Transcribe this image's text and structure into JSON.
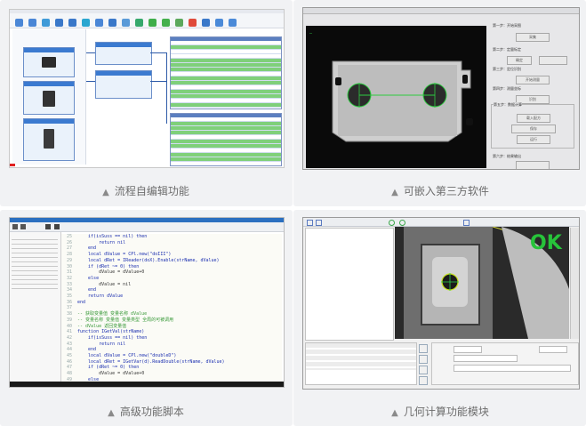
{
  "captions": {
    "flow_editor": "流程自编辑功能",
    "third_party": "可嵌入第三方软件",
    "advanced_script": "高级功能脚本",
    "geometry": "几何计算功能模块"
  },
  "bullet": "▲",
  "third_party": {
    "steps": [
      "第一步：开始采图",
      "第二步：定量标定",
      "第三步：定位识别",
      "第四步：测量坐标",
      "第五步：数据计算",
      "第六步：结果输出"
    ],
    "buttons": [
      "采集",
      "确定",
      "开始测量",
      "识别",
      "载入配方",
      "保存",
      "运行"
    ]
  },
  "script_lines": [
    [
      "25",
      "    if(isSuss == nil) then"
    ],
    [
      "26",
      "        return nil"
    ],
    [
      "27",
      "    end"
    ],
    [
      "28",
      "    local dValue = CPl.new(\"doIII\")"
    ],
    [
      "29",
      "    local dRet = IReader(doX).Enable(strName, dValue)"
    ],
    [
      "30",
      "    if (dRet ~= 0) then"
    ],
    [
      "31",
      "        dValue = dValue+0"
    ],
    [
      "32",
      "    else"
    ],
    [
      "33",
      "        dValue = nil"
    ],
    [
      "34",
      "    end"
    ],
    [
      "35",
      "    return dValue"
    ],
    [
      "36",
      "end"
    ],
    [
      "37",
      ""
    ],
    [
      "38",
      "-- 获取变量值 变量名称 dValue"
    ],
    [
      "39",
      "-- 变量名称 变量值 变量类型 全局的可被调用"
    ],
    [
      "40",
      "-- dValue 返回变量值"
    ],
    [
      "41",
      "function IGetVal(strName)"
    ],
    [
      "42",
      "    if(isSuss == nil) then"
    ],
    [
      "43",
      "        return nil"
    ],
    [
      "44",
      "    end"
    ],
    [
      "45",
      "    local dValue = CPl.new(\"doubleD\")"
    ],
    [
      "46",
      "    local dRet = IGetVar(d).ReadDouble(strName, dValue)"
    ],
    [
      "47",
      "    if (dRet ~= 0) then"
    ],
    [
      "48",
      "        dValue = dValue+0"
    ],
    [
      "49",
      "    else"
    ],
    [
      "50",
      "        dValue = nil"
    ],
    [
      "51",
      "    end"
    ],
    [
      "52",
      "    return dValue"
    ],
    [
      "53",
      "end"
    ]
  ],
  "geometry": {
    "result": "OK"
  },
  "colors": {
    "accent_blue": "#3b7ad0",
    "grid_green": "#7fd07a",
    "ok_green": "#27c43a"
  }
}
